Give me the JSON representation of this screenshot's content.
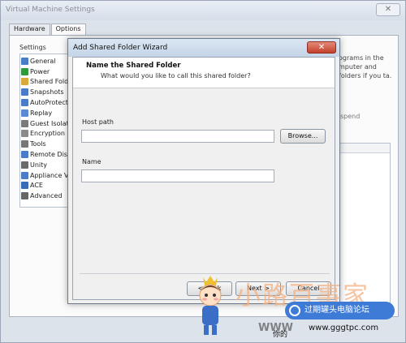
{
  "vm_window": {
    "title": "Virtual Machine Settings",
    "tabs": [
      "Hardware",
      "Options"
    ],
    "settings_heading": "Settings",
    "settings_items": [
      {
        "label": "General",
        "icon": "general-icon",
        "color": "#4a7cc7"
      },
      {
        "label": "Power",
        "icon": "power-icon",
        "color": "#2f9a3a"
      },
      {
        "label": "Shared Folders",
        "icon": "shared-folders-icon",
        "color": "#d9a93a"
      },
      {
        "label": "Snapshots",
        "icon": "snapshots-icon",
        "color": "#4a7cc7"
      },
      {
        "label": "AutoProtect",
        "icon": "autoprotect-icon",
        "color": "#4a7cc7"
      },
      {
        "label": "Replay",
        "icon": "replay-icon",
        "color": "#5a8ad6"
      },
      {
        "label": "Guest Isolation",
        "icon": "guest-isolation-icon",
        "color": "#7a7a7a"
      },
      {
        "label": "Encryption",
        "icon": "encryption-icon",
        "color": "#8a8a8a"
      },
      {
        "label": "Tools",
        "icon": "tools-icon",
        "color": "#777"
      },
      {
        "label": "Remote Display",
        "icon": "remote-display-icon",
        "color": "#4a7cc7"
      },
      {
        "label": "Unity",
        "icon": "unity-icon",
        "color": "#6a6a6a"
      },
      {
        "label": "Appliance View",
        "icon": "appliance-view-icon",
        "color": "#4a7cc7"
      },
      {
        "label": "ACE",
        "icon": "ace-icon",
        "color": "#3a6bb8"
      },
      {
        "label": "Advanced",
        "icon": "advanced-icon",
        "color": "#666"
      }
    ],
    "right_text": "ograms in the mputer and folders if you ta.",
    "right_text2": "spend"
  },
  "wizard": {
    "title": "Add Shared Folder Wizard",
    "header_title": "Name the Shared Folder",
    "header_subtitle": "What would you like to call this shared folder?",
    "host_path_label": "Host path",
    "host_path_value": "",
    "browse_label": "Browse...",
    "name_label": "Name",
    "name_value": "",
    "back_label": "< Back",
    "next_label": "Next >",
    "cancel_label": "Cancel"
  },
  "watermark": {
    "brand_text": "小路百事家",
    "badge_text": "过期罐头电脑论坛",
    "www": "WWW",
    "url": "www.gggtpc.com",
    "left_text": "你的"
  }
}
